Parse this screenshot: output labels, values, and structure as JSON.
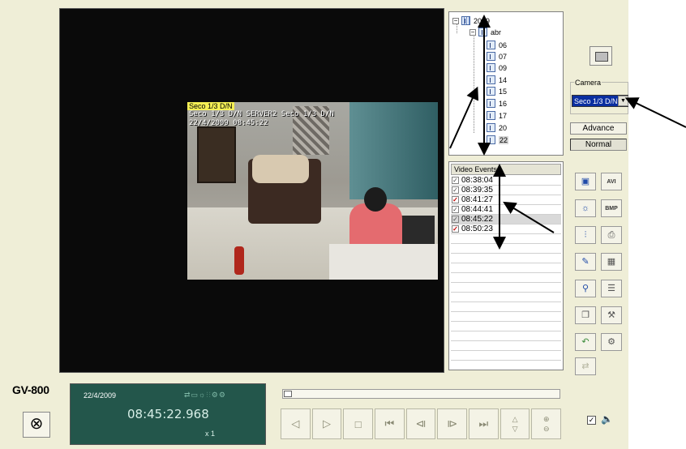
{
  "video": {
    "camera_label": "Seco 1/3 D/N",
    "osd_line1": "Seco 1/3 D/N  SERVER2 Seco 1/3 D/N",
    "osd_line2": "22/4/2009 08:45:22"
  },
  "tree": {
    "year": "2009",
    "month": "abr",
    "days": [
      "06",
      "07",
      "09",
      "14",
      "15",
      "16",
      "17",
      "20",
      "22"
    ],
    "selected_day": "22"
  },
  "events": {
    "header": "Video Events",
    "rows": [
      {
        "time": "08:38:04",
        "checked": "gray"
      },
      {
        "time": "08:39:35",
        "checked": "gray"
      },
      {
        "time": "08:41:27",
        "checked": "red"
      },
      {
        "time": "08:44:41",
        "checked": "gray"
      },
      {
        "time": "08:45:22",
        "checked": "gray"
      },
      {
        "time": "08:50:23",
        "checked": "red"
      }
    ]
  },
  "camera": {
    "legend": "Camera",
    "selected": "Seco 1/3 D/N"
  },
  "modes": {
    "advance": "Advance",
    "normal": "Normal"
  },
  "tools": {
    "avi": "AVI",
    "bmp": "BMP"
  },
  "brand": "GV-800",
  "lcd": {
    "date": "22/4/2009",
    "time": "08:45:22.968",
    "speed": "x 1"
  },
  "colors": {
    "panel_bg": "#efeed7",
    "lcd_bg": "#23564b",
    "camera_select_bg": "#0a2ea0",
    "cam_label_bg": "#f5ef55"
  }
}
